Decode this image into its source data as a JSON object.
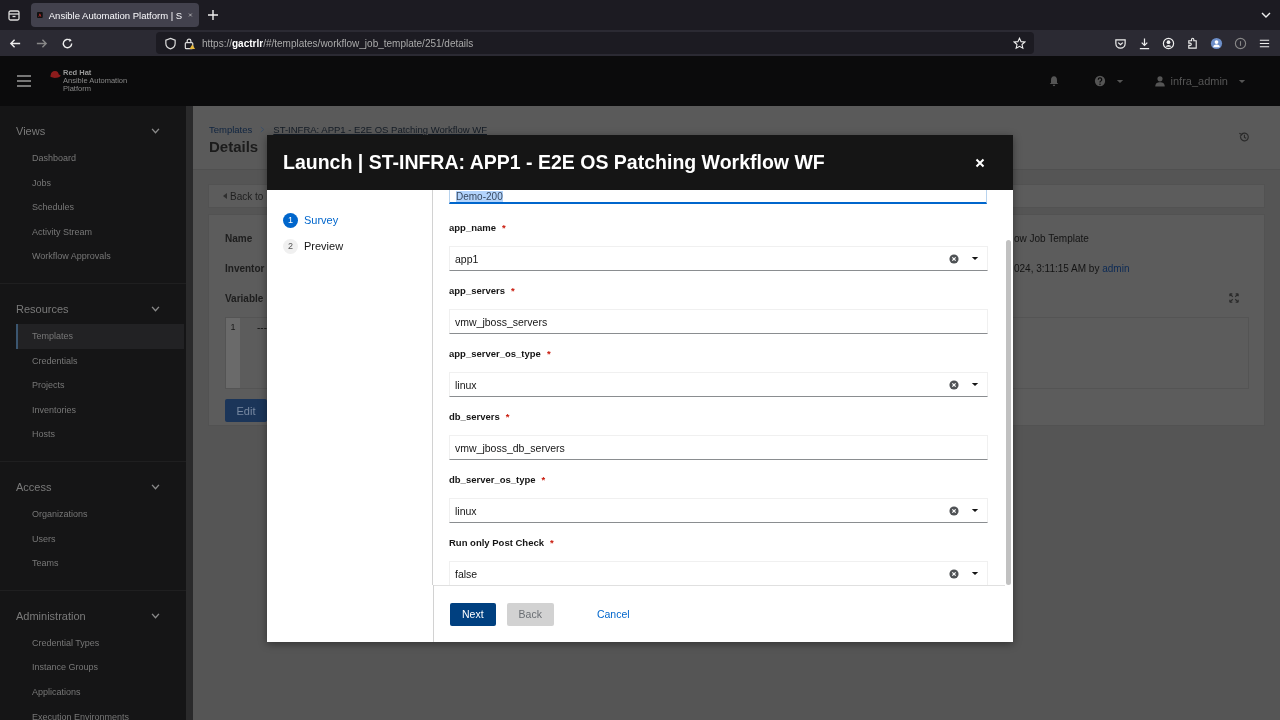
{
  "browser": {
    "tab_title": "Ansible Automation Platform | S",
    "url_scheme": "https://",
    "url_host": "gactrlr",
    "url_path": "/#/templates/workflow_job_template/251/details"
  },
  "header": {
    "logo_lines": [
      "Red Hat",
      "Ansible Automation",
      "Platform"
    ],
    "user": "infra_admin"
  },
  "sidebar": {
    "groups": [
      {
        "title": "Views",
        "expanded": true,
        "items": [
          {
            "label": "Dashboard",
            "selected": false
          },
          {
            "label": "Jobs",
            "selected": false
          },
          {
            "label": "Schedules",
            "selected": false
          },
          {
            "label": "Activity Stream",
            "selected": false
          },
          {
            "label": "Workflow Approvals",
            "selected": false
          }
        ]
      },
      {
        "title": "Resources",
        "expanded": true,
        "items": [
          {
            "label": "Templates",
            "selected": true
          },
          {
            "label": "Credentials",
            "selected": false
          },
          {
            "label": "Projects",
            "selected": false
          },
          {
            "label": "Inventories",
            "selected": false
          },
          {
            "label": "Hosts",
            "selected": false
          }
        ]
      },
      {
        "title": "Access",
        "expanded": true,
        "items": [
          {
            "label": "Organizations",
            "selected": false
          },
          {
            "label": "Users",
            "selected": false
          },
          {
            "label": "Teams",
            "selected": false
          }
        ]
      },
      {
        "title": "Administration",
        "expanded": true,
        "items": [
          {
            "label": "Credential Types",
            "selected": false
          },
          {
            "label": "Instance Groups",
            "selected": false
          },
          {
            "label": "Applications",
            "selected": false
          },
          {
            "label": "Execution Environments",
            "selected": false
          }
        ]
      }
    ]
  },
  "page": {
    "breadcrumb": [
      "Templates",
      "ST-INFRA: APP1 - E2E OS Patching Workflow WF"
    ],
    "title": "Details",
    "back_tab": "Back to",
    "details": [
      {
        "label": "Name",
        "value": "ow Job Template"
      },
      {
        "label": "Inventor",
        "value": "024, 3:11:15 AM by ",
        "link": "admin"
      }
    ],
    "variables_label": "Variable",
    "code_line": "1",
    "code_text": "---",
    "edit_button": "Edit"
  },
  "modal": {
    "title": "Launch | ST-INFRA: APP1 - E2E OS Patching Workflow WF",
    "steps": [
      {
        "number": "1",
        "label": "Survey",
        "selected": true
      },
      {
        "number": "2",
        "label": "Preview",
        "selected": false
      }
    ],
    "partial_value": "Demo-200",
    "fields": [
      {
        "label": "app_name",
        "required_mark": "*",
        "kind": "select",
        "value": "app1"
      },
      {
        "label": "app_servers",
        "required_mark": "*",
        "kind": "text",
        "value": "vmw_jboss_servers"
      },
      {
        "label": "app_server_os_type",
        "required_mark": "*",
        "kind": "select",
        "value": "linux"
      },
      {
        "label": "db_servers",
        "required_mark": "*",
        "kind": "text",
        "value": "vmw_jboss_db_servers"
      },
      {
        "label": "db_server_os_type",
        "required_mark": "*",
        "kind": "select",
        "value": "linux"
      },
      {
        "label": "Run only Post Check",
        "required_mark": "*",
        "kind": "select",
        "value": "false"
      }
    ],
    "buttons": [
      {
        "label": "Next",
        "kind": "primary",
        "disabled": false
      },
      {
        "label": "Back",
        "kind": "secondary",
        "disabled": true
      },
      {
        "label": "Cancel",
        "kind": "link",
        "disabled": false
      }
    ]
  }
}
